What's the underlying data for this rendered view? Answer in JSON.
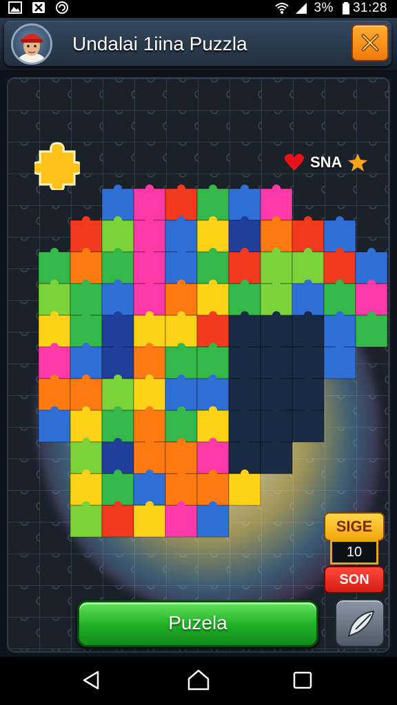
{
  "status_bar": {
    "battery_text": "3%",
    "time": "31:28",
    "left_icons": [
      "gallery-icon",
      "tool-icon",
      "sync-icon"
    ],
    "right_icons": [
      "wifi-icon",
      "signal-icon",
      "battery-icon"
    ]
  },
  "header": {
    "title": "Undalai 1iina Puzzla",
    "avatar_icon": "player-avatar",
    "close_icon": "close-icon"
  },
  "board": {
    "lives_text": "SNA",
    "lives_icons": [
      "heart-icon",
      "star-icon"
    ],
    "piece_colors": [
      "#f23a1e",
      "#34b84a",
      "#ffd21a",
      "#2f6fd6",
      "#ff3aa8",
      "#ff7a10",
      "#1f3f9a",
      "#7bd23a"
    ]
  },
  "score_widget": {
    "top_label": "SIGE",
    "value": "10",
    "bottom_label": "SON"
  },
  "actions": {
    "play_label": "Puzela",
    "tool_icon": "arrow-tool-icon"
  },
  "nav": {
    "icons": [
      "back-icon",
      "home-icon",
      "recents-icon"
    ]
  },
  "colors": {
    "accent_green": "#1fae26",
    "close_orange": "#f07a0c",
    "score_gold": "#f2a70d",
    "score_red": "#d51c12"
  }
}
